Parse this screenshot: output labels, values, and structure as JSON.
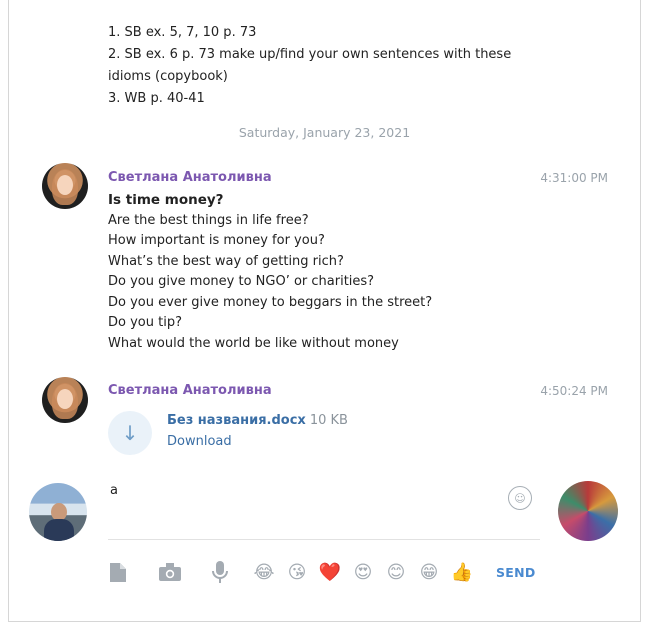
{
  "previous_message": {
    "lines": [
      "1. SB ex. 5, 7, 10 p. 73",
      "2. SB ex. 6 p. 73 make up/find your own sentences with these idioms (copybook)",
      "3. WB p. 40-41"
    ]
  },
  "date_separator": "Saturday, January 23, 2021",
  "messages": [
    {
      "sender": "Светлана Анатоливна",
      "time": "4:31:00 PM",
      "title": "Is time money?",
      "lines": [
        "Are the best things in life free?",
        "How important is money for you?",
        "What’s the best way of getting rich?",
        "Do you give money to NGO’ or charities?",
        "Do you ever give money to beggars in the street?",
        "Do you tip?",
        "What would the world be like without money"
      ]
    },
    {
      "sender": "Светлана Анатоливна",
      "time": "4:50:24 PM",
      "file": {
        "name": "Без названия.docx",
        "size": "10 KB",
        "action": "Download",
        "icon": "download-arrow-icon"
      }
    }
  ],
  "composer": {
    "input_value": "a",
    "send_label": "SEND",
    "emojis": [
      "😂",
      "😘",
      "❤️",
      "😍",
      "😊",
      "😁",
      "👍"
    ],
    "tools": [
      "document-icon",
      "camera-icon",
      "microphone-icon"
    ]
  }
}
